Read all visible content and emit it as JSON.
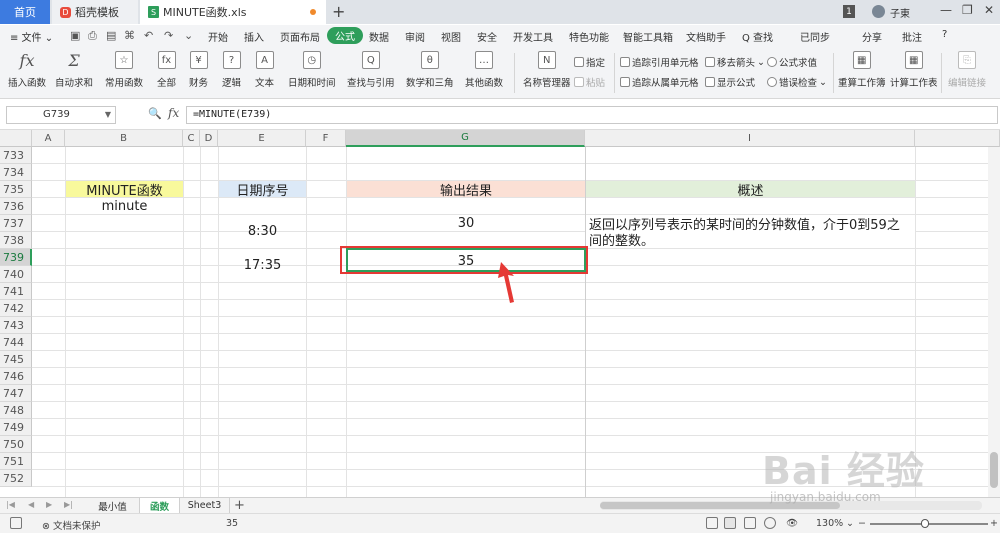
{
  "titlebar": {
    "home_tab": "首页",
    "template_tab": "稻壳模板",
    "template_logo": "D",
    "file_tab": "MINUTE函数.xls",
    "file_icon": "S",
    "new_tab": "+",
    "tab_count": "1",
    "user_name": "子東",
    "window_controls": [
      "—",
      "❐",
      "✕"
    ]
  },
  "menubar": {
    "file_menu": "≡ 文件 ⌄",
    "items": [
      "开始",
      "插入",
      "页面布局",
      "公式",
      "数据",
      "审阅",
      "视图",
      "安全",
      "开发工具",
      "特色功能",
      "智能工具箱",
      "文档助手"
    ],
    "active": "公式",
    "search": "Q 查找",
    "sync": "已同步",
    "share": "分享",
    "comment": "批注",
    "help": "?"
  },
  "ribbon": {
    "big_buttons": [
      {
        "label": "插入函数",
        "icon": "fx"
      },
      {
        "label": "自动求和",
        "icon": "Σ"
      },
      {
        "label": "常用函数",
        "icon": "☆"
      },
      {
        "label": "全部",
        "icon": "fx"
      },
      {
        "label": "财务",
        "icon": "¥"
      },
      {
        "label": "逻辑",
        "icon": "?"
      },
      {
        "label": "文本",
        "icon": "A"
      },
      {
        "label": "日期和时间",
        "icon": "◷"
      },
      {
        "label": "查找与引用",
        "icon": "Q"
      },
      {
        "label": "数学和三角",
        "icon": "θ"
      },
      {
        "label": "其他函数",
        "icon": "…"
      },
      {
        "label": "名称管理器",
        "icon": "N"
      }
    ],
    "small": {
      "specify": "指定",
      "paste": "粘贴",
      "trace_precedents": "追踪引用单元格",
      "trace_dependents": "追踪从属单元格",
      "remove_arrows": "移去箭头",
      "show_formulas": "显示公式",
      "evaluate": "公式求值",
      "error_check": "错误检查"
    },
    "recalc_workbook": "重算工作簿",
    "calc_sheet": "计算工作表",
    "edit_links": "编辑链接"
  },
  "formulabar": {
    "name_box": "G739",
    "formula": "=MINUTE(E739)",
    "fx": "fx"
  },
  "sheet": {
    "columns": [
      "A",
      "B",
      "C",
      "D",
      "E",
      "F",
      "G",
      "I"
    ],
    "active_column": "G",
    "rows": [
      "733",
      "734",
      "735",
      "736",
      "737",
      "738",
      "739",
      "740",
      "741",
      "742",
      "743",
      "744",
      "745",
      "746",
      "747",
      "748",
      "749",
      "750",
      "751",
      "752"
    ],
    "active_row": "739",
    "cells": {
      "b735": "MINUTE函数",
      "b736": "minute",
      "e735": "日期序号",
      "g735": "输出结果",
      "i735": "概述",
      "e737": "8:30",
      "g737": "30",
      "i737": "返回以序列号表示的某时间的分钟数值，介于0到59之间的整数。",
      "e739": "17:35",
      "g739": "35"
    },
    "colors": {
      "b735_fill": "#f8f99c",
      "e735_fill": "#dce9f7",
      "g735_fill": "#fbe0d5",
      "i735_fill": "#e2efda",
      "selection": "#2e9e5b",
      "annotation": "#e53935"
    }
  },
  "sheet_tabs": {
    "tabs": [
      "最小值",
      "函数",
      "Sheet3"
    ],
    "active": "函数",
    "add": "+"
  },
  "statusbar": {
    "protect": "文档未保护",
    "value": "35",
    "zoom": "130%"
  },
  "watermark": {
    "text": "Bai 经验",
    "url": "jingyan.baidu.com"
  }
}
